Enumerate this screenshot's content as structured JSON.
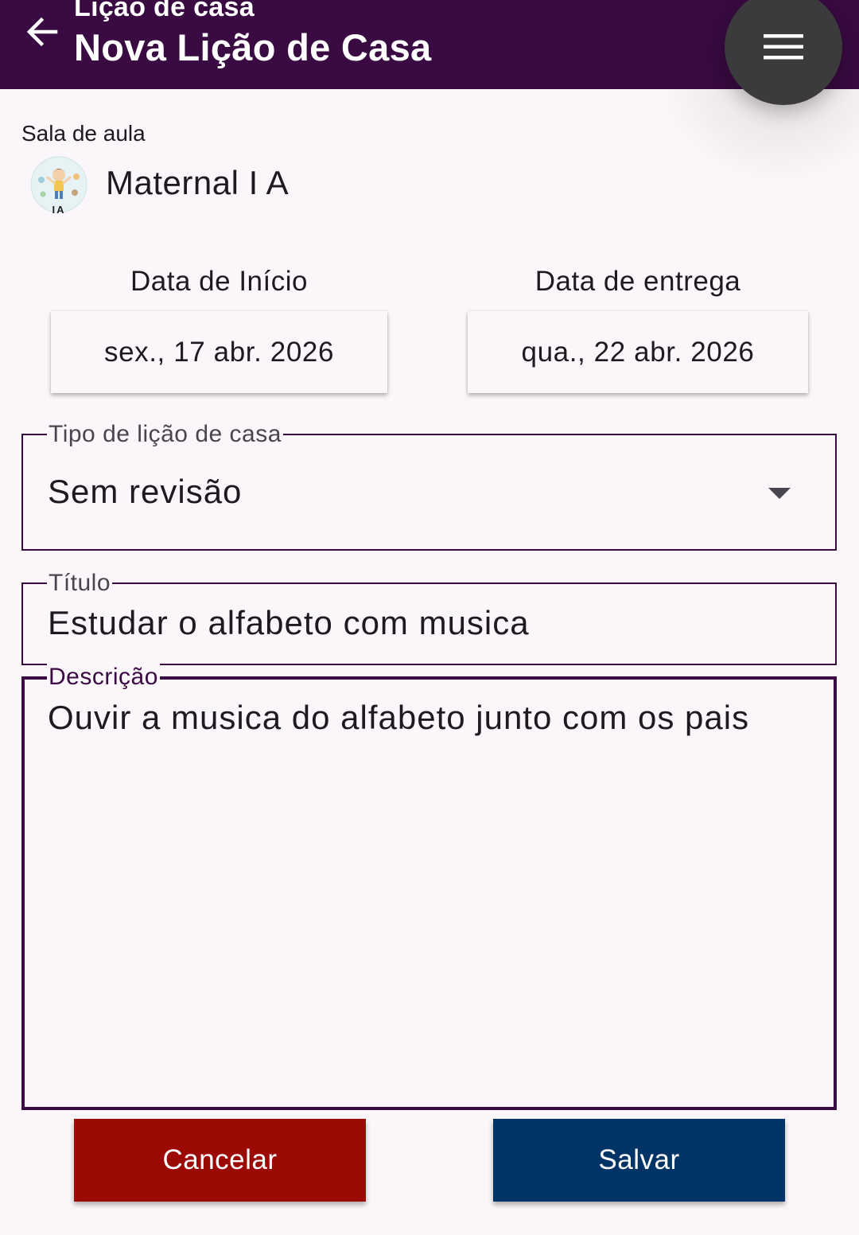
{
  "appbar": {
    "subtitle": "Lição de casa",
    "title": "Nova Lição de Casa",
    "background": "#3a0a43",
    "back_icon": "arrow-back-icon",
    "menu_icon": "hamburger-menu-icon"
  },
  "classroom": {
    "label": "Sala de aula",
    "name": "Maternal I A",
    "avatar_text": "IA"
  },
  "dates": {
    "start_label": "Data de Início",
    "start_value": "sex., 17 abr. 2026",
    "due_label": "Data de entrega",
    "due_value": "qua., 22 abr. 2026"
  },
  "form": {
    "type_label": "Tipo de lição de casa",
    "type_value": "Sem revisão",
    "title_label": "Título",
    "title_value": "Estudar o alfabeto com musica",
    "description_label": "Descrição",
    "description_value": "Ouvir a musica do alfabeto junto com os pais"
  },
  "actions": {
    "cancel_label": "Cancelar",
    "cancel_color": "#9b0a05",
    "save_label": "Salvar",
    "save_color": "#003366"
  }
}
